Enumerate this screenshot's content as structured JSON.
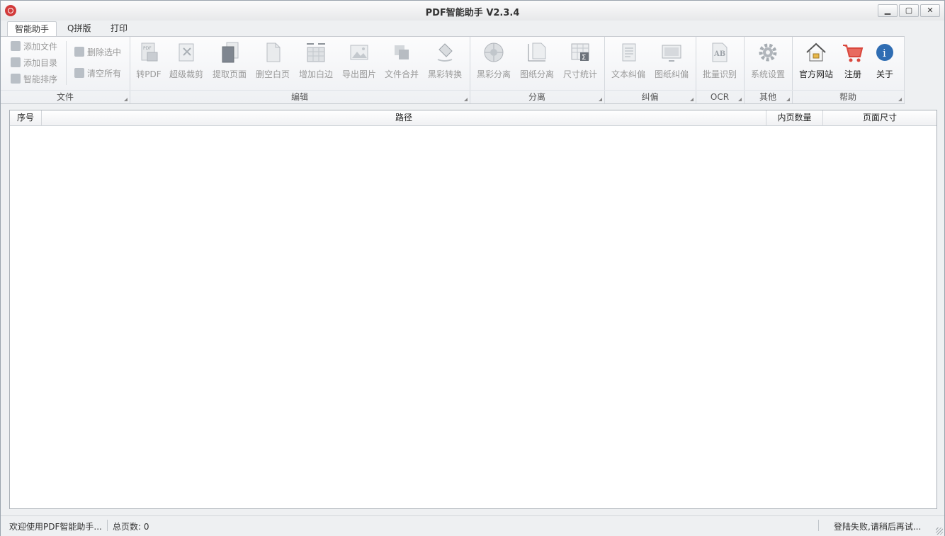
{
  "window": {
    "title": "PDF智能助手 V2.3.4",
    "minimize": "▁",
    "maximize": "▢",
    "close": "✕"
  },
  "tabs": [
    "智能助手",
    "Q拼版",
    "打印"
  ],
  "ribbon": {
    "file": {
      "label": "文件",
      "add_file": "添加文件",
      "add_dir": "添加目录",
      "smart_sort": "智能排序",
      "delete_selected": "删除选中",
      "clear_all": "清空所有"
    },
    "edit": {
      "label": "编辑",
      "to_pdf": "转PDF",
      "super_crop": "超级裁剪",
      "extract_pages": "提取页面",
      "delete_blank": "删空白页",
      "add_margin": "增加白边",
      "export_images": "导出图片",
      "merge_files": "文件合并",
      "bw_convert": "黑彩转换"
    },
    "separate": {
      "label": "分离",
      "bw_separate": "黑彩分离",
      "drawing_separate": "图纸分离",
      "size_stats": "尺寸统计"
    },
    "deskew": {
      "label": "纠偏",
      "text_deskew": "文本纠偏",
      "drawing_deskew": "图纸纠偏"
    },
    "ocr": {
      "label": "OCR",
      "batch_ocr": "批量识别"
    },
    "other": {
      "label": "其他",
      "settings": "系统设置"
    },
    "help": {
      "label": "帮助",
      "website": "官方网站",
      "register": "注册",
      "about": "关于"
    }
  },
  "table": {
    "columns": [
      "序号",
      "路径",
      "内页数量",
      "页面尺寸"
    ],
    "rows": []
  },
  "status": {
    "welcome": "欢迎使用PDF智能助手...",
    "total_pages": "总页数: 0",
    "login": "登陆失败,请稍后再试..."
  },
  "colors": {
    "accent_red": "#d9473d",
    "info_blue": "#2f6db3"
  }
}
